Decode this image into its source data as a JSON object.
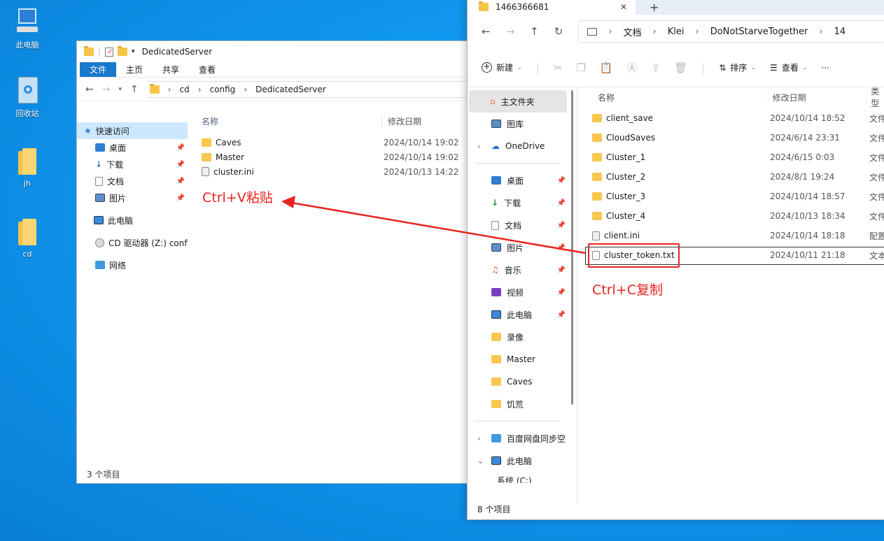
{
  "desktop": {
    "icons": [
      {
        "label": "此电脑"
      },
      {
        "label": "回收站"
      },
      {
        "label": "jh"
      },
      {
        "label": "cd"
      }
    ]
  },
  "window_old": {
    "title": "DedicatedServer",
    "ribbon": [
      "文件",
      "主页",
      "共享",
      "查看"
    ],
    "path": [
      "cd",
      "config",
      "DedicatedServer"
    ],
    "nav": {
      "quick_access": "快速访问",
      "items": [
        "桌面",
        "下载",
        "文档",
        "图片"
      ],
      "this_pc": "此电脑",
      "cd_drive": "CD 驱动器 (Z:) confi",
      "network": "网络"
    },
    "columns": [
      "名称",
      "修改日期"
    ],
    "files": [
      {
        "name": "Caves",
        "date": "2024/10/14 19:02"
      },
      {
        "name": "Master",
        "date": "2024/10/14 19:02"
      },
      {
        "name": "cluster.ini",
        "date": "2024/10/13 14:22"
      }
    ],
    "status": "3 个项目"
  },
  "window_new": {
    "tab_title": "1466366681",
    "breadcrumb": [
      "文档",
      "Klei",
      "DoNotStarveTogether",
      "14"
    ],
    "commands": {
      "new": "新建",
      "sort": "排序",
      "view": "查看"
    },
    "sidebar": {
      "home": "主文件夹",
      "gallery": "图库",
      "onedrive": "OneDrive",
      "pinned": [
        "桌面",
        "下载",
        "文档",
        "图片",
        "音乐",
        "视频",
        "此电脑"
      ],
      "folders": [
        "录像",
        "Master",
        "Caves",
        "饥荒"
      ],
      "baidu": "百度网盘同步空",
      "this_pc": "此电脑",
      "partial": "系统 (C:)"
    },
    "columns": [
      "名称",
      "修改日期",
      "类型"
    ],
    "files": [
      {
        "name": "client_save",
        "date": "2024/10/14 18:52",
        "type": "文件"
      },
      {
        "name": "CloudSaves",
        "date": "2024/6/14 23:31",
        "type": "文件"
      },
      {
        "name": "Cluster_1",
        "date": "2024/6/15 0:03",
        "type": "文件"
      },
      {
        "name": "Cluster_2",
        "date": "2024/8/1 19:24",
        "type": "文件"
      },
      {
        "name": "Cluster_3",
        "date": "2024/10/14 18:57",
        "type": "文件"
      },
      {
        "name": "Cluster_4",
        "date": "2024/10/13 18:34",
        "type": "文件"
      },
      {
        "name": "client.ini",
        "date": "2024/10/14 18:18",
        "type": "配置"
      },
      {
        "name": "cluster_token.txt",
        "date": "2024/10/11 21:18",
        "type": "文本"
      }
    ],
    "status": "8 个项目"
  },
  "annotations": {
    "paste": "Ctrl+V粘贴",
    "copy": "Ctrl+C复制",
    "color": "#e8231e"
  }
}
